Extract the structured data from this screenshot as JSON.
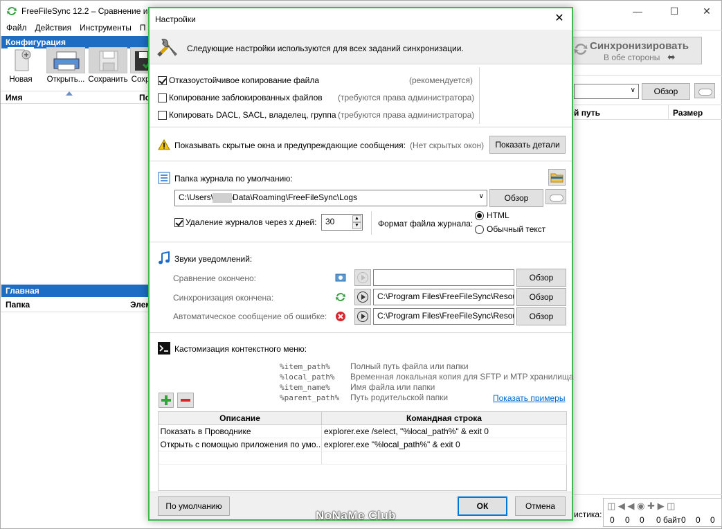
{
  "main": {
    "title": "FreeFileSync 12.2 – Сравнение и си",
    "menu": [
      "Файл",
      "Действия",
      "Инструменты",
      "П"
    ],
    "config_header": "Конфигурация",
    "toolbar": [
      "Новая",
      "Открыть...",
      "Сохранить",
      "Сохр"
    ],
    "config_cols": {
      "name": "Имя",
      "other": "По"
    },
    "main_header": "Главная",
    "main_cols": {
      "folder": "Папка",
      "elements": "Элем"
    },
    "sync_button": {
      "title": "Синхронизировать",
      "sub": "В обе стороны"
    },
    "compare_browse": "Обзор",
    "right_cols": {
      "path": "й путь",
      "size": "Размер"
    },
    "stats_label": "истика:",
    "stats_values": [
      "0",
      "0",
      "0",
      "0 байт",
      "0",
      "0",
      "0"
    ]
  },
  "dialog": {
    "title": "Настройки",
    "banner": "Следующие настройки используются для всех заданий синхронизации.",
    "options": [
      {
        "label": "Отказоустойчивое копирование файла",
        "note": "(рекомендуется)",
        "checked": true
      },
      {
        "label": "Копирование заблокированных файлов",
        "note": "(требуются права администратора)",
        "checked": false
      },
      {
        "label": "Копировать DACL, SACL, владелец, группа",
        "note": "(требуются права администратора)",
        "checked": false
      }
    ],
    "hidden_windows": {
      "label": "Показывать скрытые окна и предупреждающие сообщения:",
      "note": "(Нет скрытых окон)",
      "button": "Показать детали"
    },
    "log": {
      "label": "Папка журнала по умолчанию:",
      "path": "C:\\Users\\      \\AppData\\Roaming\\FreeFileSync\\Logs",
      "browse": "Обзор",
      "delete_label": "Удаление журналов через x дней:",
      "delete_checked": true,
      "days": "30",
      "format_label": "Формат файла журнала:",
      "format_options": [
        "HTML",
        "Обычный текст"
      ],
      "format_selected": 0
    },
    "sounds": {
      "label": "Звуки уведомлений:",
      "items": [
        {
          "label": "Сравнение окончено:",
          "path": "",
          "browse": "Обзор"
        },
        {
          "label": "Синхронизация окончена:",
          "path": "C:\\Program Files\\FreeFileSync\\Resou",
          "browse": "Обзор"
        },
        {
          "label": "Автоматическое сообщение об ошибке:",
          "path": "C:\\Program Files\\FreeFileSync\\Resou",
          "browse": "Обзор"
        }
      ]
    },
    "context_menu": {
      "label": "Кастомизация контекстного меню:",
      "macros": [
        {
          "name": "%item_path%",
          "desc": "Полный путь файла или папки"
        },
        {
          "name": "%local_path%",
          "desc": "Временная локальная копия для SFTP и MTP хранилища"
        },
        {
          "name": "%item_name%",
          "desc": "Имя файла или папки"
        },
        {
          "name": "%parent_path%",
          "desc": "Путь родительской папки"
        }
      ],
      "examples_link": "Показать примеры",
      "columns": [
        "Описание",
        "Командная строка"
      ],
      "rows": [
        {
          "desc": "Показать в Проводнике",
          "cmd": "explorer.exe /select, \"%local_path%\" & exit 0"
        },
        {
          "desc": "Открыть с помощью приложения по умо...",
          "cmd": "explorer.exe \"%local_path%\" & exit 0"
        }
      ]
    },
    "footer": {
      "defaults": "По умолчанию",
      "ok": "ОК",
      "cancel": "Отмена"
    }
  },
  "watermark": "NoNaMe Club",
  "colors": {
    "accent_blue": "#1d6dc4",
    "dialog_border": "#3dba4e",
    "link": "#0066cc"
  }
}
